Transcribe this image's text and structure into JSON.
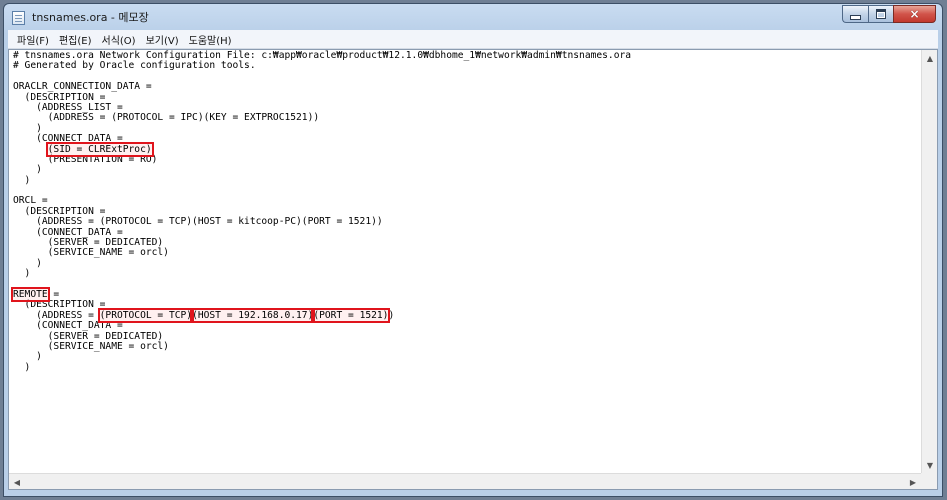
{
  "window": {
    "title": "tnsnames.ora - 메모장",
    "close_symbol": "×"
  },
  "menu": {
    "items": [
      "파일(F)",
      "편집(E)",
      "서식(O)",
      "보기(V)",
      "도움말(H)"
    ]
  },
  "editor": {
    "lines": [
      {
        "segments": [
          {
            "text": "# tnsnames.ora Network Configuration File: c:₩app₩oracle₩product₩12.1.0₩dbhome_1₩network₩admin₩tnsnames.ora"
          }
        ]
      },
      {
        "segments": [
          {
            "text": "# Generated by Oracle configuration tools."
          }
        ]
      },
      {
        "segments": [
          {
            "text": ""
          }
        ]
      },
      {
        "segments": [
          {
            "text": "ORACLR_CONNECTION_DATA ="
          }
        ]
      },
      {
        "segments": [
          {
            "text": "  (DESCRIPTION ="
          }
        ]
      },
      {
        "segments": [
          {
            "text": "    (ADDRESS_LIST ="
          }
        ]
      },
      {
        "segments": [
          {
            "text": "      (ADDRESS = (PROTOCOL = IPC)(KEY = EXTPROC1521))"
          }
        ]
      },
      {
        "segments": [
          {
            "text": "    )"
          }
        ]
      },
      {
        "segments": [
          {
            "text": "    (CONNECT_DATA ="
          }
        ]
      },
      {
        "segments": [
          {
            "text": "      "
          },
          {
            "text": "(SID = CLRExtProc)",
            "highlight": true
          }
        ]
      },
      {
        "segments": [
          {
            "text": "      (PRESENTATION = RO)"
          }
        ]
      },
      {
        "segments": [
          {
            "text": "    )"
          }
        ]
      },
      {
        "segments": [
          {
            "text": "  )"
          }
        ]
      },
      {
        "segments": [
          {
            "text": ""
          }
        ]
      },
      {
        "segments": [
          {
            "text": "ORCL ="
          }
        ]
      },
      {
        "segments": [
          {
            "text": "  (DESCRIPTION ="
          }
        ]
      },
      {
        "segments": [
          {
            "text": "    (ADDRESS = (PROTOCOL = TCP)(HOST = kitcoop-PC)(PORT = 1521))"
          }
        ]
      },
      {
        "segments": [
          {
            "text": "    (CONNECT_DATA ="
          }
        ]
      },
      {
        "segments": [
          {
            "text": "      (SERVER = DEDICATED)"
          }
        ]
      },
      {
        "segments": [
          {
            "text": "      (SERVICE_NAME = orcl)"
          }
        ]
      },
      {
        "segments": [
          {
            "text": "    )"
          }
        ]
      },
      {
        "segments": [
          {
            "text": "  )"
          }
        ]
      },
      {
        "segments": [
          {
            "text": ""
          }
        ]
      },
      {
        "segments": [
          {
            "text": "REMOTE",
            "highlight": true
          },
          {
            "text": " ="
          }
        ]
      },
      {
        "segments": [
          {
            "text": "  (DESCRIPTION ="
          }
        ]
      },
      {
        "segments": [
          {
            "text": "    (ADDRESS = "
          },
          {
            "text": "(PROTOCOL = TCP)",
            "highlight": true
          },
          {
            "text": "(HOST = 192.168.0.17)",
            "highlight": true
          },
          {
            "text": "(PORT = 1521)",
            "highlight": true
          },
          {
            "text": ")"
          }
        ]
      },
      {
        "segments": [
          {
            "text": "    (CONNECT_DATA ="
          }
        ]
      },
      {
        "segments": [
          {
            "text": "      (SERVER = DEDICATED)"
          }
        ]
      },
      {
        "segments": [
          {
            "text": "      (SERVICE_NAME = orcl)"
          }
        ]
      },
      {
        "segments": [
          {
            "text": "    )"
          }
        ]
      },
      {
        "segments": [
          {
            "text": "  )"
          }
        ]
      }
    ]
  },
  "colors": {
    "highlight_box": "#e0141c",
    "title_bar": "#c9dcf1"
  }
}
